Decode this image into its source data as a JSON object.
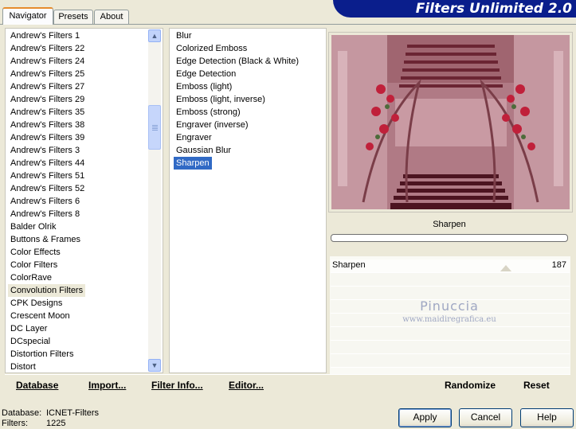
{
  "tabs": [
    {
      "label": "Navigator"
    },
    {
      "label": "Presets"
    },
    {
      "label": "About"
    }
  ],
  "app_title": "Filters Unlimited 2.0",
  "categories": [
    "Andrew's Filters 1",
    "Andrew's Filters 22",
    "Andrew's Filters 24",
    "Andrew's Filters 25",
    "Andrew's Filters 27",
    "Andrew's Filters 29",
    "Andrew's Filters 35",
    "Andrew's Filters 38",
    "Andrew's Filters 39",
    "Andrew's Filters 3",
    "Andrew's Filters 44",
    "Andrew's Filters 51",
    "Andrew's Filters 52",
    "Andrew's Filters 6",
    "Andrew's Filters 8",
    "Balder Olrik",
    "Buttons & Frames",
    "Color Effects",
    "Color Filters",
    "ColorRave",
    "Convolution Filters",
    "CPK Designs",
    "Crescent Moon",
    "DC Layer",
    "DCspecial",
    "Distortion Filters",
    "Distort"
  ],
  "selected_category": "Convolution Filters",
  "filters": [
    "Blur",
    "Colorized Emboss",
    "Edge Detection (Black & White)",
    "Edge Detection",
    "Emboss (light)",
    "Emboss (light, inverse)",
    "Emboss (strong)",
    "Engraver (inverse)",
    "Engraver",
    "Gaussian Blur",
    "Sharpen"
  ],
  "selected_filter": "Sharpen",
  "filter_name": "Sharpen",
  "param": {
    "label": "Sharpen",
    "value": "187",
    "level": 0.733
  },
  "watermark": {
    "name": "Pinuccia",
    "site": "www.maidiregrafica.eu"
  },
  "buttons": {
    "database": "Database",
    "import": "Import...",
    "filter_info": "Filter Info...",
    "editor": "Editor...",
    "randomize": "Randomize",
    "reset": "Reset",
    "apply": "Apply",
    "cancel": "Cancel",
    "help": "Help"
  },
  "status": {
    "database_label": "Database:",
    "database_value": "ICNET-Filters",
    "filters_label": "Filters:",
    "filters_value": "1225"
  },
  "colors": {
    "title_banner": "#0a1e8c",
    "selection": "#316ac5",
    "active_tab_accent": "#e68b2c"
  },
  "icons": [
    "scroll-up-icon",
    "scroll-down-icon"
  ]
}
